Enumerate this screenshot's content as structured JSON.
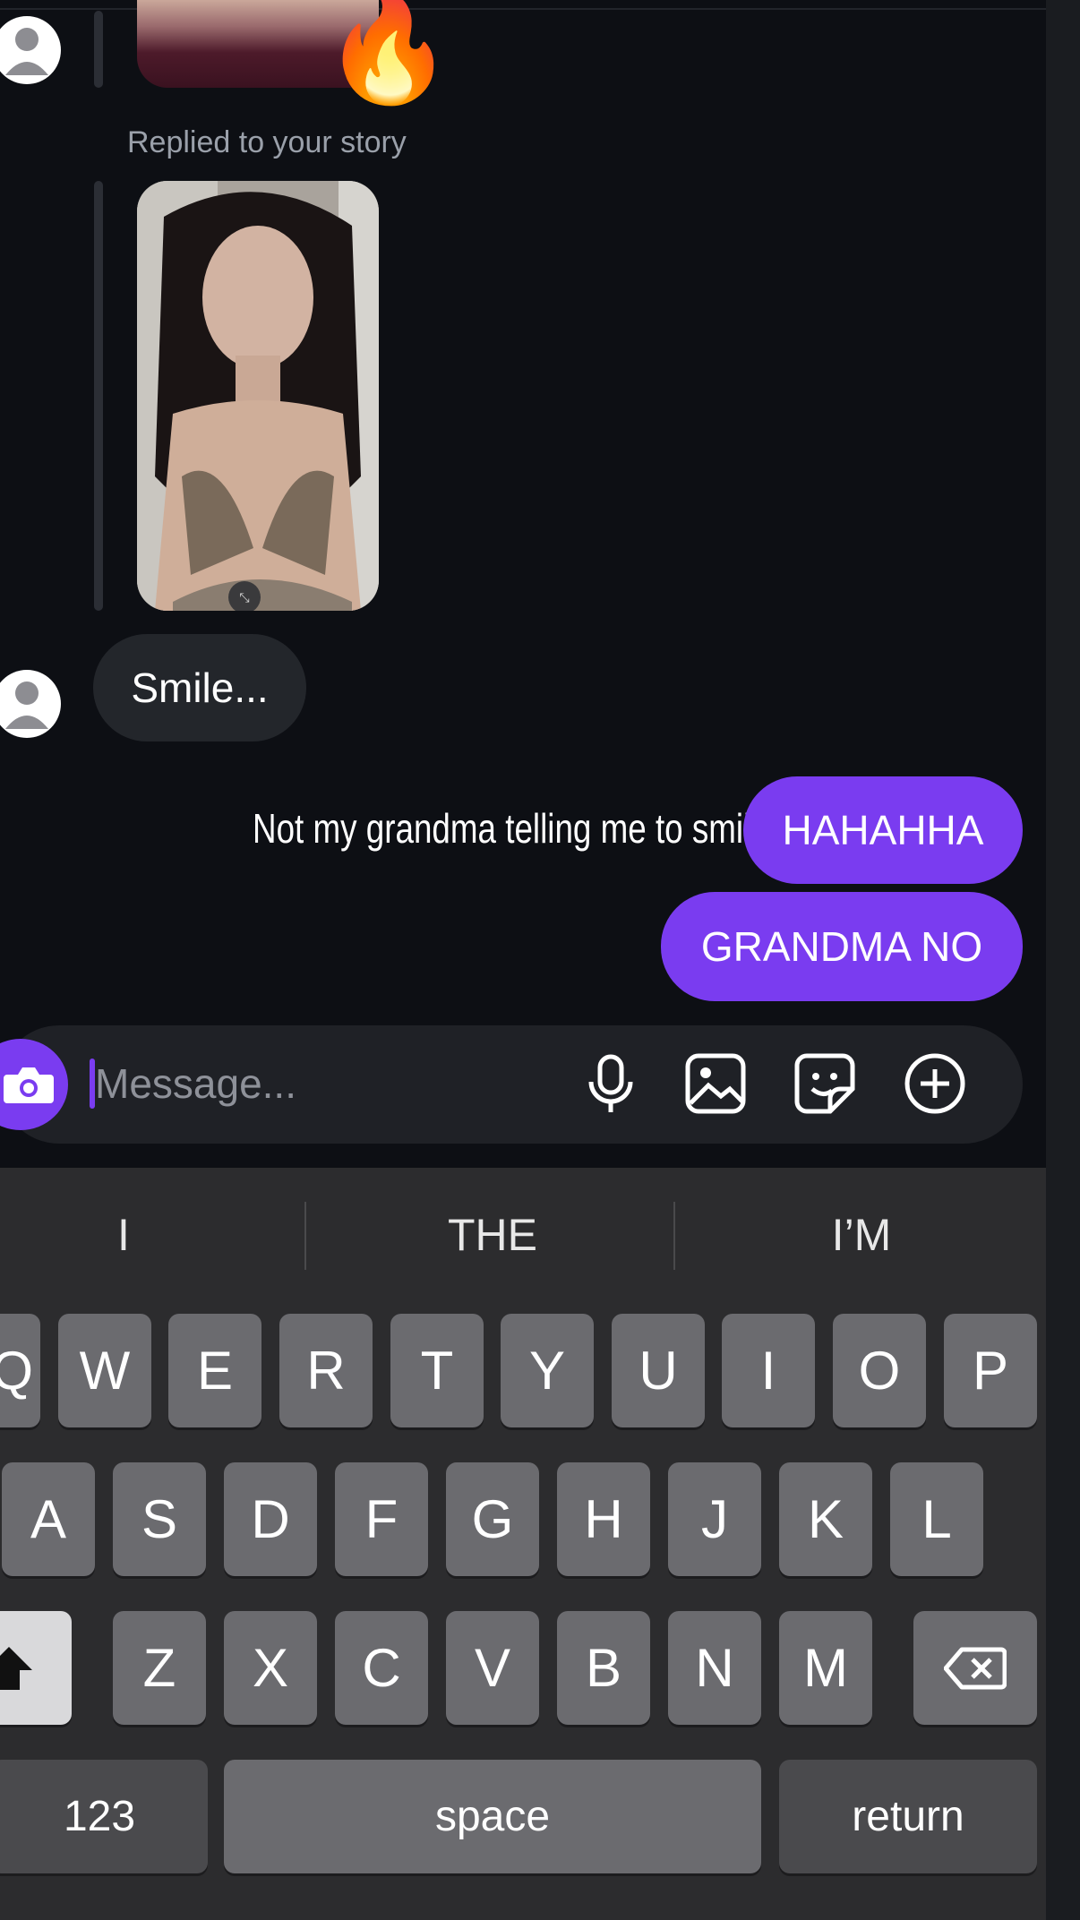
{
  "thread": {
    "reply_label": "Replied to your story",
    "story_emoji": "🔥",
    "incoming_message": "Smile...",
    "caption": "Not my grandma telling me to smile",
    "outgoing_messages": [
      "HAHAHHA",
      "GRANDMA NO"
    ]
  },
  "composer": {
    "placeholder": "Message...",
    "icons": [
      "camera-icon",
      "microphone-icon",
      "gallery-icon",
      "sticker-icon",
      "plus-circle-icon"
    ]
  },
  "keyboard": {
    "suggestions": [
      "I",
      "THE",
      "I’M"
    ],
    "row1": [
      "Q",
      "W",
      "E",
      "R",
      "T",
      "Y",
      "U",
      "I",
      "O",
      "P"
    ],
    "row2": [
      "A",
      "S",
      "D",
      "F",
      "G",
      "H",
      "J",
      "K",
      "L"
    ],
    "row3": [
      "Z",
      "X",
      "C",
      "V",
      "B",
      "N",
      "M"
    ],
    "numbers_label": "123",
    "space_label": "space",
    "return_label": "return"
  },
  "colors": {
    "background": "#0d0f14",
    "accent": "#7a3cf0",
    "incoming_bubble": "#23262b",
    "keyboard": "#2c2c2e"
  }
}
